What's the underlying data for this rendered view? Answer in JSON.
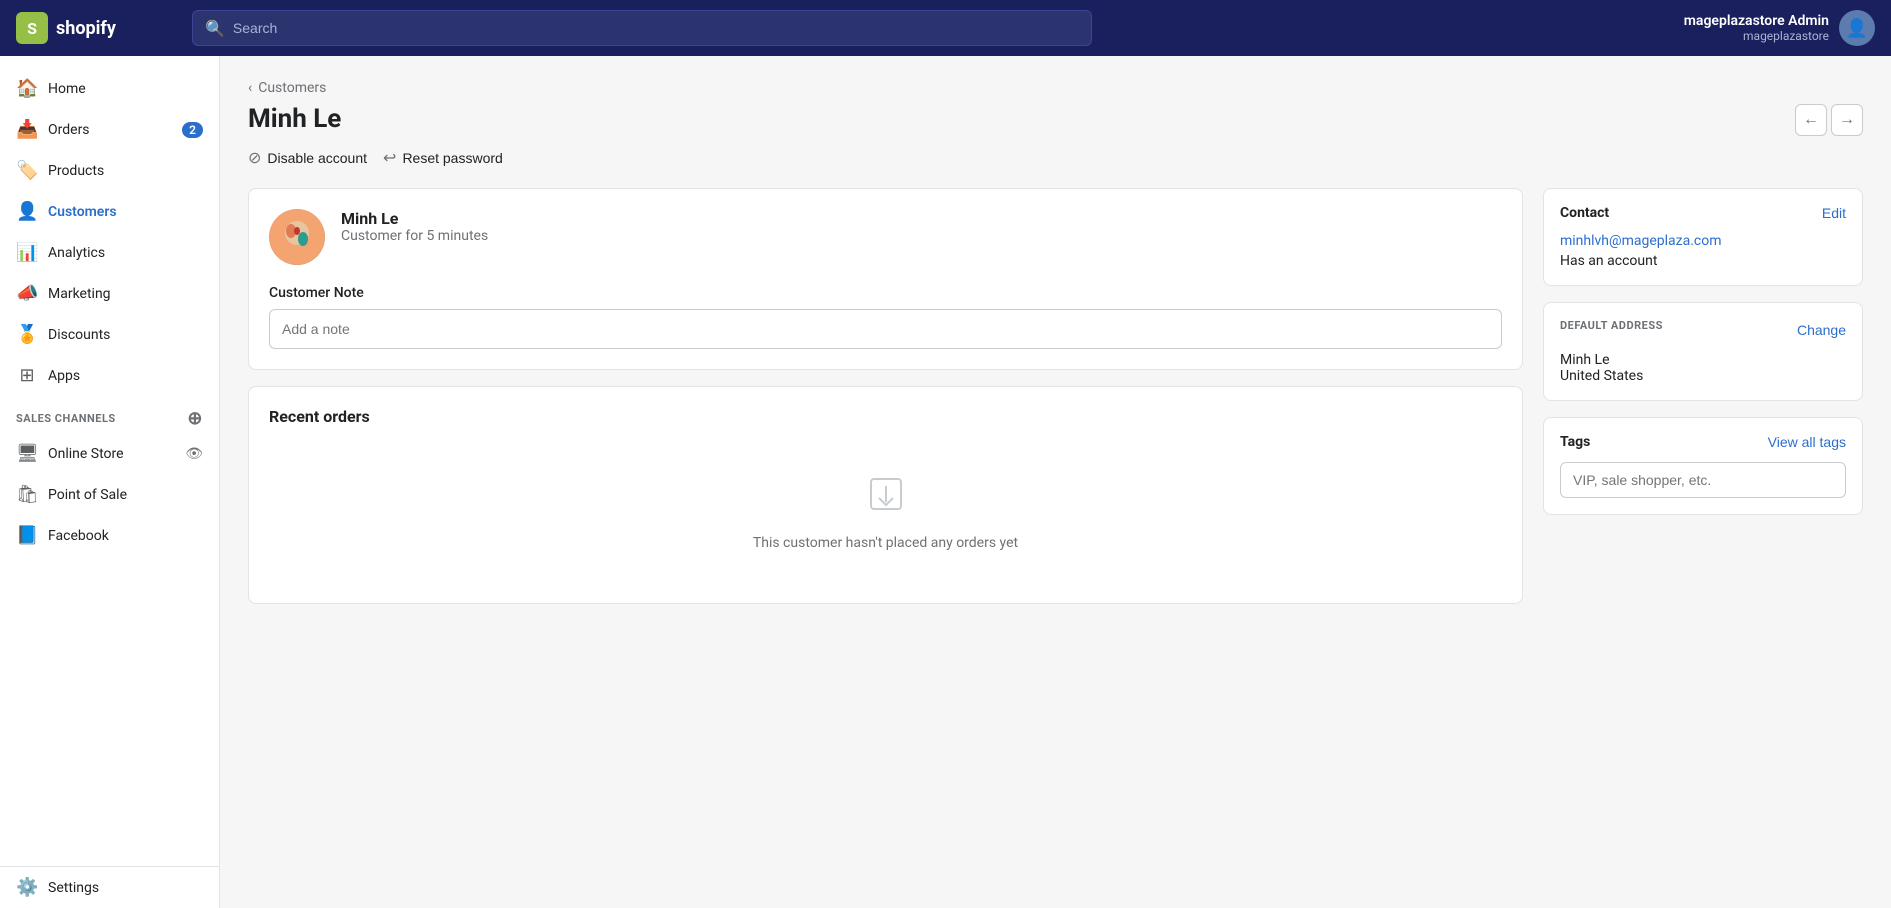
{
  "topnav": {
    "logo_text": "shopify",
    "search_placeholder": "Search",
    "user_name": "mageplazastore Admin",
    "user_store": "mageplazastore"
  },
  "sidebar": {
    "items": [
      {
        "id": "home",
        "label": "Home",
        "icon": "🏠",
        "badge": null,
        "active": false
      },
      {
        "id": "orders",
        "label": "Orders",
        "icon": "📥",
        "badge": "2",
        "active": false
      },
      {
        "id": "products",
        "label": "Products",
        "icon": "🏷️",
        "badge": null,
        "active": false
      },
      {
        "id": "customers",
        "label": "Customers",
        "icon": "👤",
        "badge": null,
        "active": true
      },
      {
        "id": "analytics",
        "label": "Analytics",
        "icon": "📊",
        "badge": null,
        "active": false
      },
      {
        "id": "marketing",
        "label": "Marketing",
        "icon": "📣",
        "badge": null,
        "active": false
      },
      {
        "id": "discounts",
        "label": "Discounts",
        "icon": "🏅",
        "badge": null,
        "active": false
      },
      {
        "id": "apps",
        "label": "Apps",
        "icon": "⊞",
        "badge": null,
        "active": false
      }
    ],
    "sales_channels_label": "SALES CHANNELS",
    "channels": [
      {
        "id": "online-store",
        "label": "Online Store",
        "icon": "🖥",
        "has_eye": true
      },
      {
        "id": "point-of-sale",
        "label": "Point of Sale",
        "icon": "🛍",
        "has_eye": false
      },
      {
        "id": "facebook",
        "label": "Facebook",
        "icon": "📘",
        "has_eye": false
      }
    ],
    "settings_label": "Settings"
  },
  "breadcrumb": {
    "label": "Customers"
  },
  "page": {
    "title": "Minh Le",
    "disable_account_label": "Disable account",
    "reset_password_label": "Reset password"
  },
  "customer_card": {
    "name": "Minh Le",
    "since": "Customer for 5 minutes",
    "note_label": "Customer Note",
    "note_placeholder": "Add a note"
  },
  "recent_orders": {
    "title": "Recent orders",
    "empty_text": "This customer hasn't placed any orders yet"
  },
  "contact": {
    "title": "Contact",
    "edit_label": "Edit",
    "email": "minhlvh@mageplaza.com",
    "account_status": "Has an account"
  },
  "default_address": {
    "section_label": "DEFAULT ADDRESS",
    "change_label": "Change",
    "name": "Minh Le",
    "country": "United States"
  },
  "tags": {
    "title": "Tags",
    "view_all_label": "View all tags",
    "input_placeholder": "VIP, sale shopper, etc."
  }
}
